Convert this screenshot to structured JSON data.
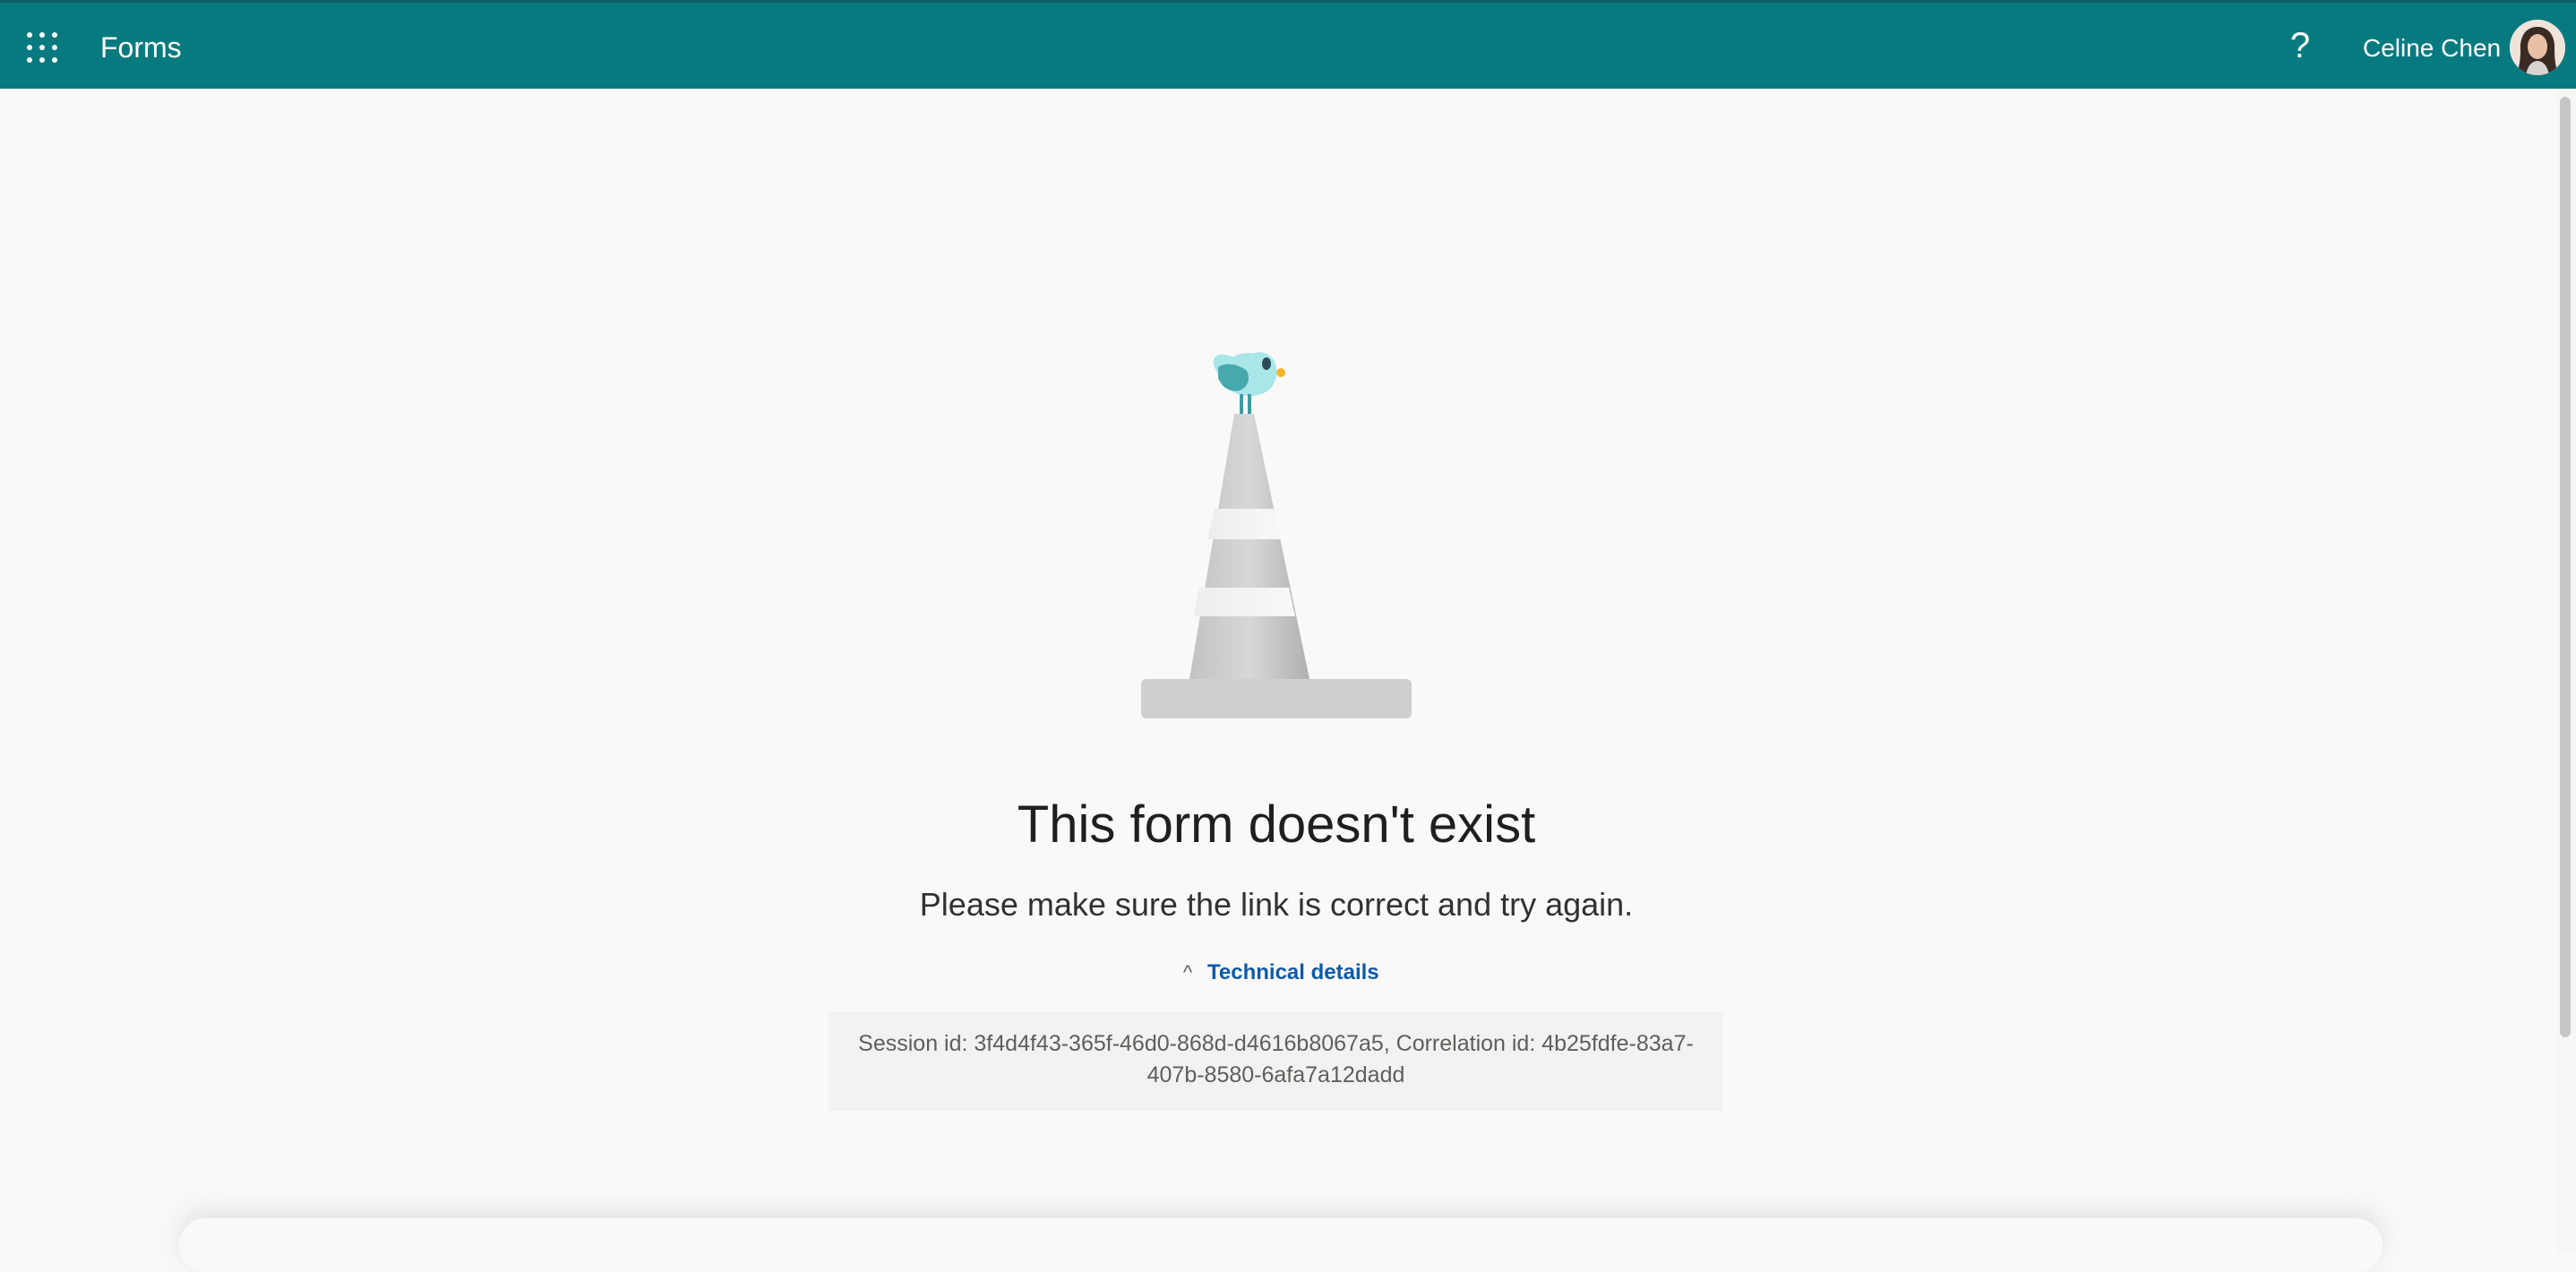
{
  "header": {
    "app_title": "Forms",
    "help_glyph": "?",
    "user_name": "Celine Chen",
    "background_color": "#077a7f",
    "icons": [
      "waffle-icon",
      "help-icon",
      "avatar"
    ]
  },
  "error": {
    "headline": "This form doesn't exist",
    "subtitle": "Please make sure the link is correct and try again.",
    "technical_details_label": "Technical details",
    "technical_details_chevron": "^",
    "details_text": "Session id: 3f4d4f43-365f-46d0-868d-d4616b8067a5, Correlation id: 4b25fdfe-83a7-407b-8580-6afa7a12dadd",
    "illustration": "traffic-cone-with-bird"
  },
  "colors": {
    "page_background": "#faf9f8",
    "link": "#0f5aa6",
    "bird": "#a8e6ea",
    "cone": "#c8c8c8"
  }
}
